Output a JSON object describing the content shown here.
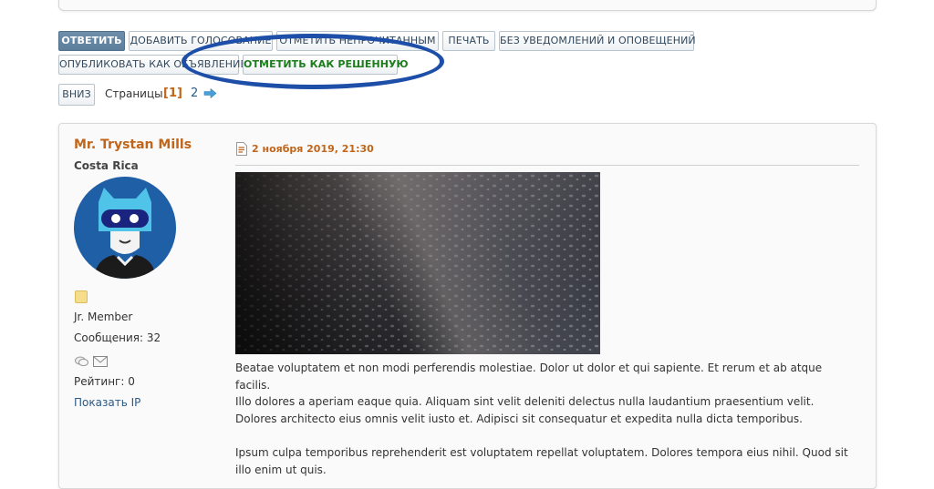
{
  "toolbar": {
    "reply": "ОТВЕТИТЬ",
    "add_poll": "ДОБАВИТЬ ГОЛОСОВАНИЕ",
    "mark_unread": "ОТМЕТИТЬ НЕПРОЧИТАННЫМ",
    "print": "ПЕЧАТЬ",
    "no_notifications": "БЕЗ УВЕДОМЛЕНИЙ И ОПОВЕЩЕНИЙ",
    "publish_announcement": "ОПУБЛИКОВАТЬ КАК ОБЪЯВЛЕНИЕ",
    "mark_solved": "ОТМЕТИТЬ КАК РЕШЕННУЮ"
  },
  "pagination": {
    "down": "ВНИЗ",
    "label": "Страницы:",
    "current": "[1]",
    "next_page": "2",
    "next_icon": "arrow-right-icon"
  },
  "post": {
    "author": {
      "name": "Mr. Trystan Mills",
      "location": "Costa Rica",
      "rank": "Jr. Member",
      "posts": "Сообщения: 32",
      "rating": "Рейтинг: 0",
      "show_ip": "Показать IP"
    },
    "date": "2 ноября 2019, 21:30",
    "paragraphs": [
      "Beatae voluptatem et non modi perferendis molestiae. Dolor ut dolor et qui sapiente. Et rerum et ab atque facilis.",
      "Illo dolores a aperiam eaque quia. Aliquam sint velit deleniti delectus nulla laudantium praesentium velit. Dolores architecto eius omnis velit iusto et. Adipisci sit consequatur et expedita nulla dicta temporibus.",
      "Ipsum culpa temporibus reprehenderit est voluptatem repellat voluptatem. Dolores tempora eius nihil. Quod sit illo enim ut quis."
    ]
  },
  "colors": {
    "accent": "#c0651a",
    "link": "#2c5a85",
    "primary_button": "#5d7f9c",
    "solved_text": "#1b7d1b",
    "annotation_ellipse": "#1d4fa8"
  }
}
